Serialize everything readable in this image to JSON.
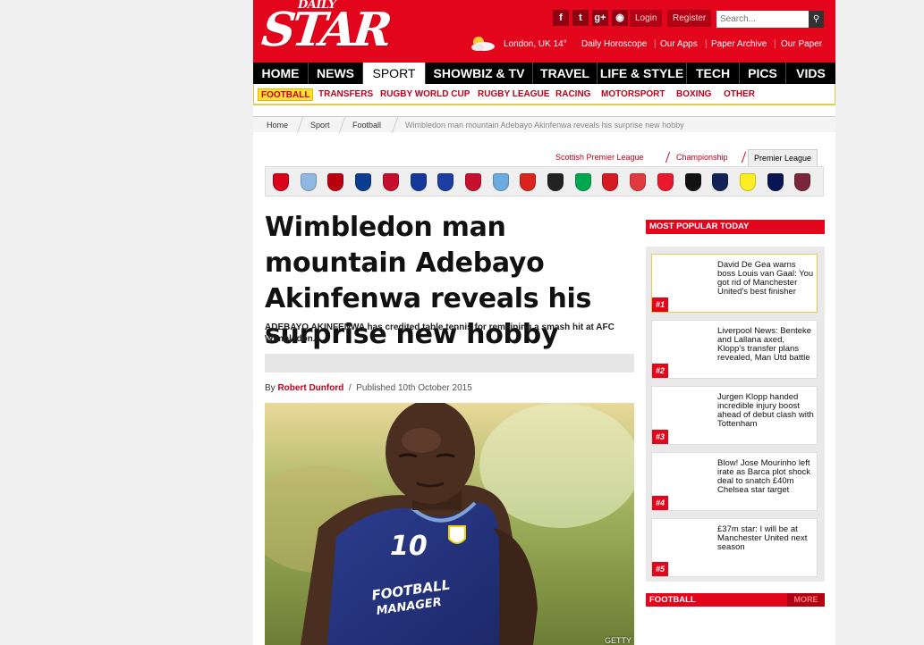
{
  "logo": {
    "daily": "DAILY",
    "star": "STAR"
  },
  "header": {
    "social": [
      {
        "icon": "facebook-icon",
        "glyph": "f"
      },
      {
        "icon": "twitter-icon",
        "glyph": "t"
      },
      {
        "icon": "google-plus-icon",
        "glyph": "g+"
      },
      {
        "icon": "rss-icon",
        "glyph": "◉"
      }
    ],
    "login": "Login",
    "register": "Register",
    "search_placeholder": "Search...",
    "weather": "London, UK 14°",
    "links": [
      "Daily Horoscope",
      "Our Apps",
      "Paper Archive",
      "Our Paper"
    ]
  },
  "nav": {
    "items": [
      "HOME",
      "NEWS",
      "SPORT",
      "SHOWBIZ & TV",
      "TRAVEL",
      "LIFE & STYLE",
      "TECH",
      "PICS",
      "VIDS"
    ],
    "active": "SPORT"
  },
  "subnav": {
    "items": [
      "FOOTBALL",
      "TRANSFERS",
      "RUGBY WORLD CUP",
      "RUGBY LEAGUE",
      "RACING",
      "MOTORSPORT",
      "BOXING",
      "OTHER"
    ],
    "active": "FOOTBALL"
  },
  "breadcrumb": [
    "Home",
    "Sport",
    "Football",
    "Wimbledon man mountain Adebayo Akinfenwa reveals his surprise new hobby"
  ],
  "league_tabs": {
    "items": [
      "Scottish Premier League",
      "Championship",
      "Premier League"
    ],
    "active": "Premier League"
  },
  "club_badges": [
    {
      "icon": "arsenal-badge-icon",
      "color": "#d9001a"
    },
    {
      "icon": "aston-villa-badge-icon",
      "color": "#8fb8e0"
    },
    {
      "icon": "bournemouth-badge-icon",
      "color": "#b8000f"
    },
    {
      "icon": "chelsea-badge-icon",
      "color": "#0a3d8f"
    },
    {
      "icon": "crystal-palace-badge-icon",
      "color": "#c4102e"
    },
    {
      "icon": "everton-badge-icon",
      "color": "#12399a"
    },
    {
      "icon": "leicester-badge-icon",
      "color": "#1b3ea0"
    },
    {
      "icon": "liverpool-badge-icon",
      "color": "#c4102e"
    },
    {
      "icon": "man-city-badge-icon",
      "color": "#6cabdd"
    },
    {
      "icon": "man-united-badge-icon",
      "color": "#d8241c"
    },
    {
      "icon": "newcastle-badge-icon",
      "color": "#222222"
    },
    {
      "icon": "norwich-badge-icon",
      "color": "#00a650"
    },
    {
      "icon": "southampton-badge-icon",
      "color": "#d71920"
    },
    {
      "icon": "stoke-badge-icon",
      "color": "#e03a3e"
    },
    {
      "icon": "sunderland-badge-icon",
      "color": "#eb172b"
    },
    {
      "icon": "swansea-badge-icon",
      "color": "#111111"
    },
    {
      "icon": "tottenham-badge-icon",
      "color": "#132257"
    },
    {
      "icon": "watford-badge-icon",
      "color": "#fbee23"
    },
    {
      "icon": "west-brom-badge-icon",
      "color": "#091453"
    },
    {
      "icon": "west-ham-badge-icon",
      "color": "#7a263a"
    }
  ],
  "article": {
    "headline": "Wimbledon man mountain Adebayo Akinfenwa reveals his surprise new hobby",
    "standfirst": "ADEBAYO AKINFENWA has credited table tennis for remaining a smash hit at AFC Wimbledon.",
    "by": "By",
    "author": "Robert Dunford",
    "sep": "/",
    "published": "Published 10th October 2015",
    "photo_credit": "GETTY",
    "shirt_number": "10",
    "shirt_sponsor": [
      "FOOTBALL",
      "MANAGER"
    ]
  },
  "most_popular": {
    "title": "MOST POPULAR TODAY",
    "items": [
      {
        "rank": "#1",
        "title": "David De Gea warns boss Louis van Gaal: You got rid of Manchester United's best finisher"
      },
      {
        "rank": "#2",
        "title": "Liverpool News: Benteke and Lallana axed, Klopp's transfer plans revealed, Man Utd battle"
      },
      {
        "rank": "#3",
        "title": "Jurgen Klopp handed incredible injury boost ahead of debut clash with Tottenham"
      },
      {
        "rank": "#4",
        "title": "Blow! Jose Mourinho left irate as Barca plot shock deal to snatch £40m Chelsea star target"
      },
      {
        "rank": "#5",
        "title": "£37m star: I will be at Manchester United next season"
      }
    ]
  },
  "football_box": {
    "title": "FOOTBALL",
    "more": "MORE"
  },
  "colors": {
    "brand_red": "#e3051b",
    "nav_black": "#000000",
    "subnav_yellow": "#ffe033"
  }
}
